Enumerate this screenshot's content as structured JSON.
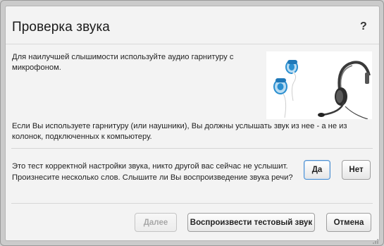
{
  "dialog": {
    "title": "Проверка звука",
    "help_label": "?"
  },
  "content": {
    "intro_text": "Для наилучшей слышимости используйте аудио гарнитуру с микрофоном.",
    "headset_text": "Если Вы используете гарнитуру (или наушники), Вы должны услышать звук из нее - а не из колонок, подключенных к компьютеру.",
    "question_text": "Это тест корректной настройки звука, никто другой вас сейчас не услышит. Произнесите несколько слов. Слышите ли Вы воспроизведение звука речи?"
  },
  "answers": {
    "yes_label": "Да",
    "no_label": "Нет"
  },
  "footer": {
    "next_label": "Далее",
    "play_label": "Воспроизвести тестовый звук",
    "cancel_label": "Отмена"
  },
  "illustration": {
    "icon_names": [
      "earphones-icon",
      "headset-with-microphone-icon"
    ],
    "accent_color": "#2a8fd0"
  }
}
